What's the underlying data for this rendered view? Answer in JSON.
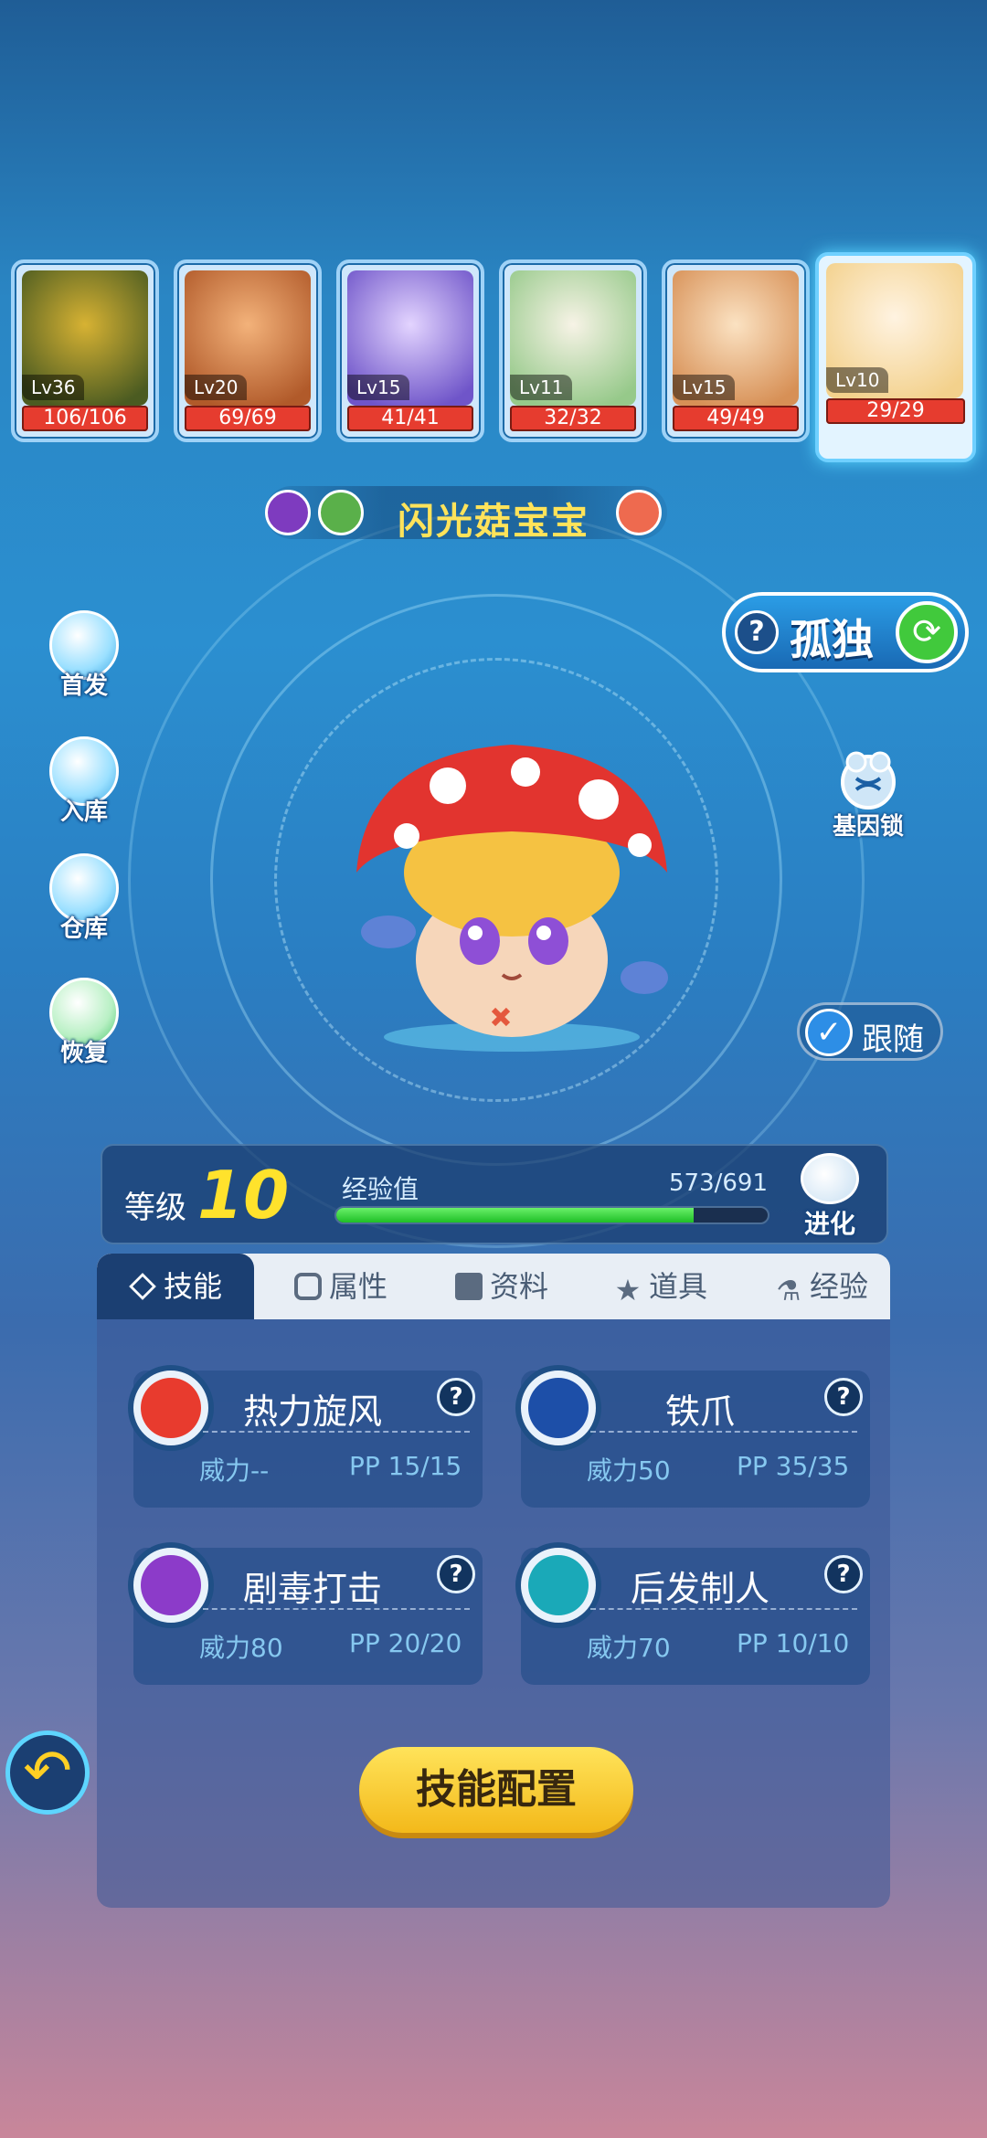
{
  "party": [
    {
      "level": "Lv36",
      "hp": "106/106",
      "colors": [
        "#4b5b21",
        "#d7b233"
      ]
    },
    {
      "level": "Lv20",
      "hp": "69/69",
      "colors": [
        "#b15a2a",
        "#f3b27a"
      ]
    },
    {
      "level": "Lv15",
      "hp": "41/41",
      "colors": [
        "#6f55c9",
        "#e3d4ff"
      ]
    },
    {
      "level": "Lv11",
      "hp": "32/32",
      "colors": [
        "#96c98a",
        "#f7f3e6"
      ]
    },
    {
      "level": "Lv15",
      "hp": "49/49",
      "colors": [
        "#d79056",
        "#fbe2c2"
      ]
    },
    {
      "level": "Lv10",
      "hp": "29/29",
      "colors": [
        "#f3d18c",
        "#fff3e1"
      ]
    }
  ],
  "pet": {
    "name": "闪光菇宝宝"
  },
  "side_menu": [
    {
      "label": "首发",
      "icon": "gift-icon"
    },
    {
      "label": "入库",
      "icon": "house-icon"
    },
    {
      "label": "仓库",
      "icon": "storage-icon"
    },
    {
      "label": "恢复",
      "icon": "potion-icon"
    }
  ],
  "solo_tag": {
    "label": "孤独",
    "help": "?"
  },
  "gene_lock": {
    "label": "基因锁"
  },
  "follow": {
    "label": "跟随",
    "checked": true
  },
  "level": {
    "label": "等级",
    "value": "10"
  },
  "exp": {
    "label": "经验值",
    "current": 573,
    "max": 691,
    "text": "573/691"
  },
  "evolve": {
    "label": "进化"
  },
  "tabs": [
    {
      "label": "技能",
      "active": true
    },
    {
      "label": "属性",
      "active": false
    },
    {
      "label": "资料",
      "active": false
    },
    {
      "label": "道具",
      "active": false
    },
    {
      "label": "经验",
      "active": false
    }
  ],
  "skills": [
    {
      "name": "热力旋风",
      "power": "威力--",
      "pp": "PP 15/15",
      "icon": "fire-icon",
      "color": "#e83b2e"
    },
    {
      "name": "铁爪",
      "power": "威力50",
      "pp": "PP 35/35",
      "icon": "iron-mask-icon",
      "color": "#1d4fa8"
    },
    {
      "name": "剧毒打击",
      "power": "威力80",
      "pp": "PP 20/20",
      "icon": "skull-icon",
      "color": "#8c3bc9"
    },
    {
      "name": "后发制人",
      "power": "威力70",
      "pp": "PP 10/10",
      "icon": "snowflake-icon",
      "color": "#1aa9b8"
    }
  ],
  "config_button": "技能配置",
  "help_symbol": "?"
}
